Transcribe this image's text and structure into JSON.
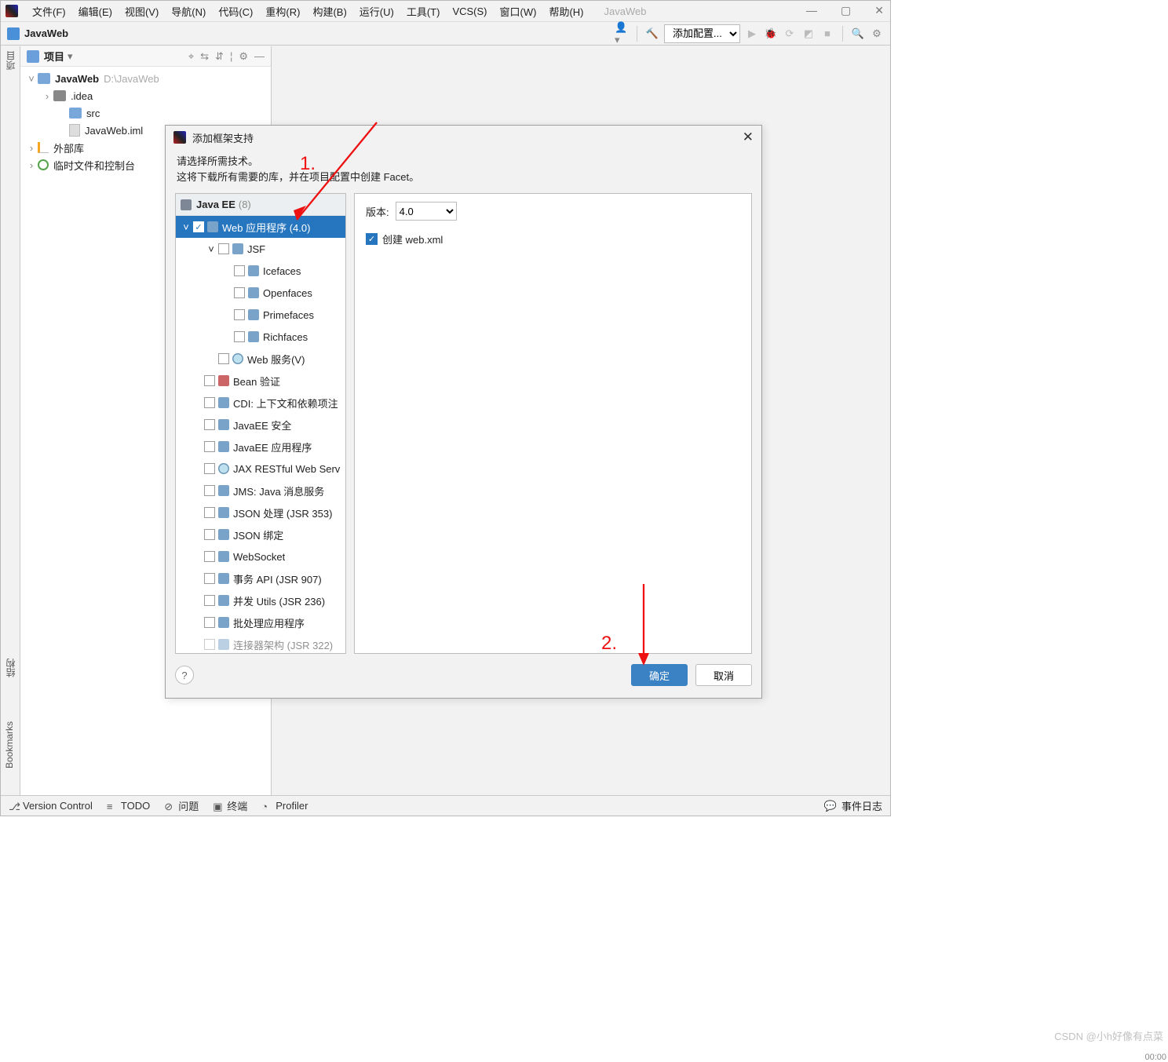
{
  "app": {
    "project_name": "JavaWeb",
    "project_path": "D:\\JavaWeb"
  },
  "menu": {
    "file": "文件(F)",
    "edit": "编辑(E)",
    "view": "视图(V)",
    "nav": "导航(N)",
    "code": "代码(C)",
    "refactor": "重构(R)",
    "build": "构建(B)",
    "run": "运行(U)",
    "tools": "工具(T)",
    "vcs": "VCS(S)",
    "window": "窗口(W)",
    "help": "帮助(H)"
  },
  "toolbar": {
    "add_config": "添加配置..."
  },
  "sidepanel": {
    "title": "项目",
    "nodes": {
      "root": "JavaWeb",
      "idea": ".idea",
      "src": "src",
      "iml": "JavaWeb.iml",
      "ext": "外部库",
      "scratch": "临时文件和控制台"
    }
  },
  "leftgutter": {
    "project": "项目",
    "structure": "结构",
    "bookmarks": "Bookmarks"
  },
  "status": {
    "vcs": "Version Control",
    "todo": "TODO",
    "problems": "问题",
    "terminal": "终端",
    "profiler": "Profiler",
    "events": "事件日志"
  },
  "dialog": {
    "title": "添加框架支持",
    "instr1": "请选择所需技术。",
    "instr2": "这将下载所有需要的库，并在项目配置中创建 Facet。",
    "group": "Java EE",
    "group_count": "(8)",
    "items": {
      "web": "Web 应用程序 (4.0)",
      "jsf": "JSF",
      "icefaces": "Icefaces",
      "openfaces": "Openfaces",
      "primefaces": "Primefaces",
      "richfaces": "Richfaces",
      "webservice": "Web 服务(V)",
      "bean": "Bean 验证",
      "cdi": "CDI: 上下文和依赖项注",
      "sec": "JavaEE 安全",
      "app": "JavaEE 应用程序",
      "jax": "JAX RESTful Web Serv",
      "jms": "JMS: Java 消息服务",
      "jsonp": "JSON 处理 (JSR 353)",
      "jsonb": "JSON 绑定",
      "ws": "WebSocket",
      "txn": "事务 API (JSR 907)",
      "conc": "并发 Utils (JSR 236)",
      "batch": "批处理应用程序",
      "conn": "连接器架构 (JSR 322)"
    },
    "opts": {
      "version_label": "版本:",
      "version_value": "4.0",
      "create_webxml": "创建 web.xml"
    },
    "buttons": {
      "ok": "确定",
      "cancel": "取消"
    }
  },
  "annotations": {
    "one": "1.",
    "two": "2."
  },
  "footer": {
    "watermark": "CSDN @小h好像有点菜",
    "time": "00:00"
  }
}
